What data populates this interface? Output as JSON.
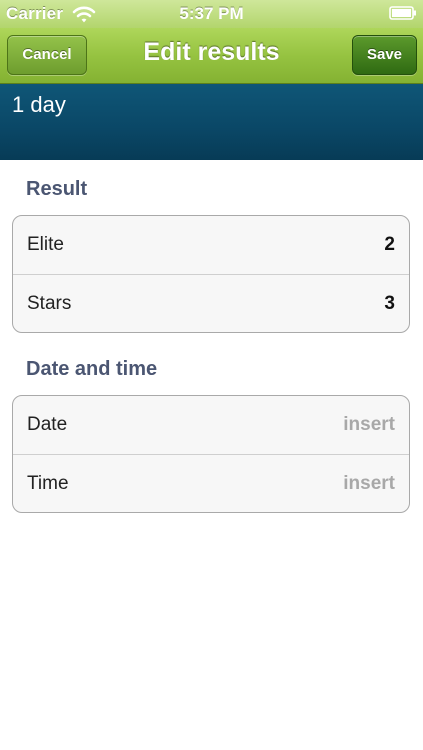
{
  "status_bar": {
    "carrier": "Carrier",
    "time": "5:37 PM",
    "wifi_icon": "wifi-icon",
    "battery_icon": "battery-icon"
  },
  "nav_bar": {
    "title": "Edit results",
    "cancel_label": "Cancel",
    "save_label": "Save"
  },
  "header": {
    "text": "1 day"
  },
  "sections": [
    {
      "title": "Result",
      "rows": [
        {
          "label": "Elite",
          "value": "2"
        },
        {
          "label": "Stars",
          "value": "3"
        }
      ]
    },
    {
      "title": "Date and time",
      "rows": [
        {
          "label": "Date",
          "value": "insert"
        },
        {
          "label": "Time",
          "value": "insert"
        }
      ]
    }
  ],
  "colors": {
    "nav_green": "#96c341",
    "save_button": "#3f7d1c",
    "header_blue": "#0a4766",
    "section_title": "#4b5672",
    "placeholder_gray": "#a8a8a8"
  }
}
